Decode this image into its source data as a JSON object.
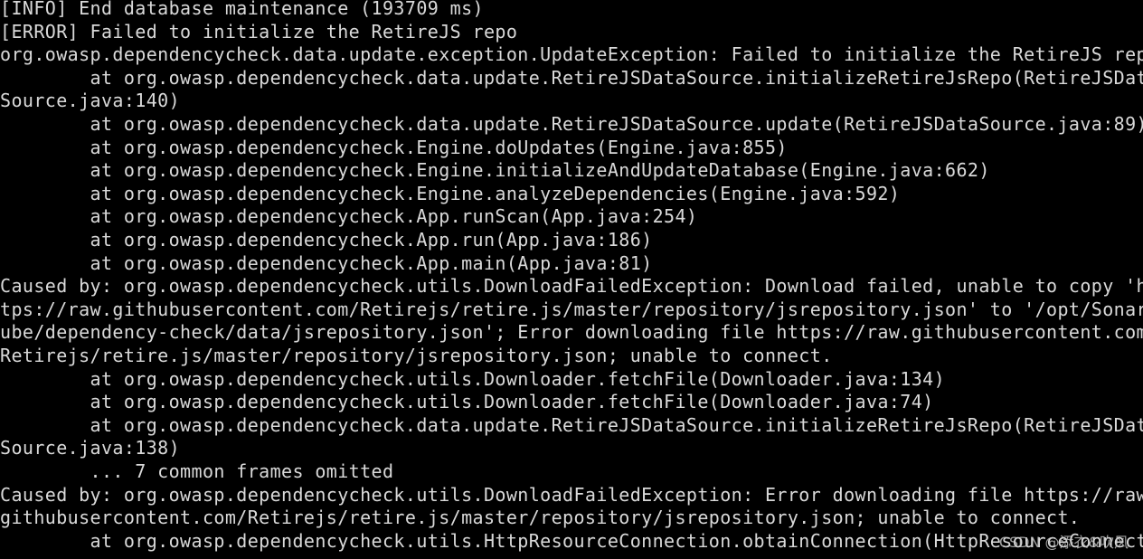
{
  "terminal": {
    "colors": {
      "background": "#000000",
      "foreground": "#d9d9d9"
    },
    "lines": [
      "[INFO] End database maintenance (193709 ms)",
      "[ERROR] Failed to initialize the RetireJS repo",
      "org.owasp.dependencycheck.data.update.exception.UpdateException: Failed to initialize the RetireJS repo",
      "        at org.owasp.dependencycheck.data.update.RetireJSDataSource.initializeRetireJsRepo(RetireJSData",
      "Source.java:140)",
      "        at org.owasp.dependencycheck.data.update.RetireJSDataSource.update(RetireJSDataSource.java:89)",
      "        at org.owasp.dependencycheck.Engine.doUpdates(Engine.java:855)",
      "        at org.owasp.dependencycheck.Engine.initializeAndUpdateDatabase(Engine.java:662)",
      "        at org.owasp.dependencycheck.Engine.analyzeDependencies(Engine.java:592)",
      "        at org.owasp.dependencycheck.App.runScan(App.java:254)",
      "        at org.owasp.dependencycheck.App.run(App.java:186)",
      "        at org.owasp.dependencycheck.App.main(App.java:81)",
      "Caused by: org.owasp.dependencycheck.utils.DownloadFailedException: Download failed, unable to copy 'ht",
      "tps://raw.githubusercontent.com/Retirejs/retire.js/master/repository/jsrepository.json' to '/opt/SonarQ",
      "ube/dependency-check/data/jsrepository.json'; Error downloading file https://raw.githubusercontent.com/",
      "Retirejs/retire.js/master/repository/jsrepository.json; unable to connect.",
      "        at org.owasp.dependencycheck.utils.Downloader.fetchFile(Downloader.java:134)",
      "        at org.owasp.dependencycheck.utils.Downloader.fetchFile(Downloader.java:74)",
      "        at org.owasp.dependencycheck.data.update.RetireJSDataSource.initializeRetireJsRepo(RetireJSData",
      "Source.java:138)",
      "        ... 7 common frames omitted",
      "Caused by: org.owasp.dependencycheck.utils.DownloadFailedException: Error downloading file https://raw.",
      "githubusercontent.com/Retirejs/retire.js/master/repository/jsrepository.json; unable to connect.",
      "        at org.owasp.dependencycheck.utils.HttpResourceConnection.obtainConnection(HttpResourceConnection."
    ]
  },
  "watermark": {
    "text": "CSDN @添衣&吹风"
  }
}
